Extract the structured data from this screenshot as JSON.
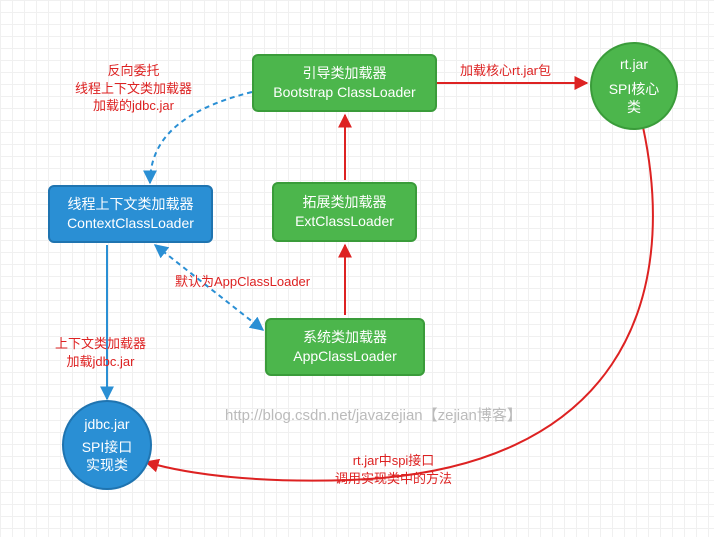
{
  "nodes": {
    "bootstrap": {
      "line1": "引导类加载器",
      "line2": "Bootstrap ClassLoader"
    },
    "ext": {
      "line1": "拓展类加载器",
      "line2": "ExtClassLoader"
    },
    "app": {
      "line1": "系统类加载器",
      "line2": "AppClassLoader"
    },
    "context": {
      "line1": "线程上下文类加载器",
      "line2": "ContextClassLoader"
    },
    "rtjar": {
      "line1": "rt.jar",
      "line2": "SPI核心类"
    },
    "jdbcjar": {
      "line1": "jdbc.jar",
      "line2": "SPI接口",
      "line3": "实现类"
    }
  },
  "labels": {
    "reverse_delegate": {
      "l1": "反向委托",
      "l2": "线程上下文类加载器",
      "l3": "加载的jdbc.jar"
    },
    "load_rtjar": "加载核心rt.jar包",
    "default_app": "默认为AppClassLoader",
    "context_load_jdbc": {
      "l1": "上下文类加载器",
      "l2": "加载jdbc.jar"
    },
    "rtjar_spi": {
      "l1": "rt.jar中spi接口",
      "l2": "调用实现类中的方法"
    }
  },
  "watermark": "http://blog.csdn.net/javazejian【zejian博客】"
}
